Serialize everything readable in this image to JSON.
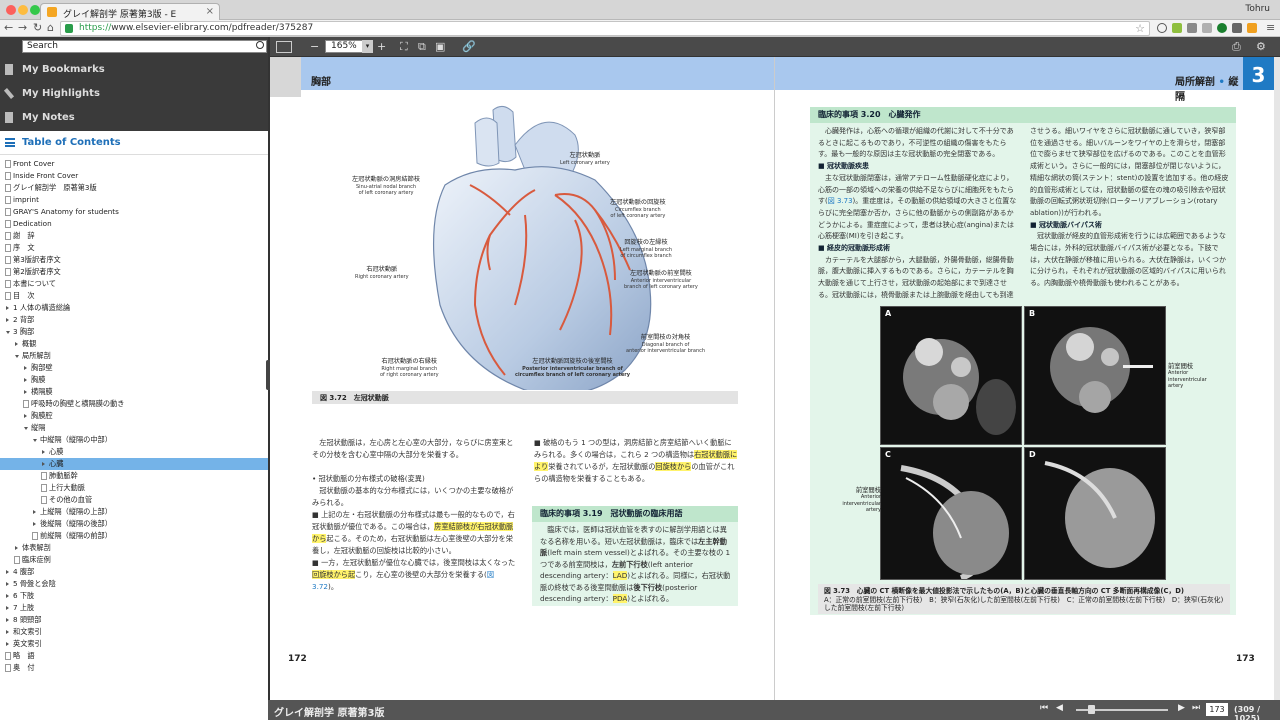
{
  "browser": {
    "tab_title": "グレイ解剖学 原著第3版 - E",
    "url_scheme": "https://",
    "url_rest": "www.elsevier-elibrary.com/pdfreader/375287",
    "user": "Tohru"
  },
  "sidebar": {
    "search_value": "Search",
    "links": [
      "My Bookmarks",
      "My Highlights",
      "My Notes"
    ],
    "toc_title": "Table of Contents",
    "toc": [
      {
        "label": "Front Cover",
        "level": 0,
        "type": "doc"
      },
      {
        "label": "Inside Front Cover",
        "level": 0,
        "type": "doc"
      },
      {
        "label": "グレイ解剖学　原著第3版",
        "level": 0,
        "type": "doc"
      },
      {
        "label": "imprint",
        "level": 0,
        "type": "doc"
      },
      {
        "label": "GRAY'S Anatomy for students",
        "level": 0,
        "type": "doc"
      },
      {
        "label": "Dedication",
        "level": 0,
        "type": "doc"
      },
      {
        "label": "謝　辞",
        "level": 0,
        "type": "doc"
      },
      {
        "label": "序　文",
        "level": 0,
        "type": "doc"
      },
      {
        "label": "第3版訳者序文",
        "level": 0,
        "type": "doc"
      },
      {
        "label": "第2版訳者序文",
        "level": 0,
        "type": "doc"
      },
      {
        "label": "本書について",
        "level": 0,
        "type": "doc"
      },
      {
        "label": "目　次",
        "level": 0,
        "type": "doc"
      },
      {
        "label": "1 人体の構造総論",
        "level": 0,
        "type": "closed"
      },
      {
        "label": "2 背部",
        "level": 0,
        "type": "closed"
      },
      {
        "label": "3 胸部",
        "level": 0,
        "type": "open"
      },
      {
        "label": "概観",
        "level": 1,
        "type": "closed"
      },
      {
        "label": "局所解剖",
        "level": 1,
        "type": "open"
      },
      {
        "label": "胸部壁",
        "level": 2,
        "type": "closed"
      },
      {
        "label": "胸膜",
        "level": 2,
        "type": "closed"
      },
      {
        "label": "横隔膜",
        "level": 2,
        "type": "closed"
      },
      {
        "label": "呼吸時の胸壁と横隔膜の動き",
        "level": 2,
        "type": "doc"
      },
      {
        "label": "胸膜腔",
        "level": 2,
        "type": "closed"
      },
      {
        "label": "縦隔",
        "level": 2,
        "type": "open"
      },
      {
        "label": "中縦隔（縦隔の中部）",
        "level": 3,
        "type": "open"
      },
      {
        "label": "心膜",
        "level": 4,
        "type": "closed"
      },
      {
        "label": "心臓",
        "level": 4,
        "type": "closed",
        "selected": true
      },
      {
        "label": "肺動脈幹",
        "level": 4,
        "type": "doc"
      },
      {
        "label": "上行大動脈",
        "level": 4,
        "type": "doc"
      },
      {
        "label": "その他の血管",
        "level": 4,
        "type": "doc"
      },
      {
        "label": "上縦隔（縦隔の上部）",
        "level": 3,
        "type": "closed"
      },
      {
        "label": "後縦隔（縦隔の後部）",
        "level": 3,
        "type": "closed"
      },
      {
        "label": "前縦隔（縦隔の前部）",
        "level": 3,
        "type": "doc"
      },
      {
        "label": "体表解剖",
        "level": 1,
        "type": "closed"
      },
      {
        "label": "臨床症例",
        "level": 1,
        "type": "doc"
      },
      {
        "label": "4 腹部",
        "level": 0,
        "type": "closed"
      },
      {
        "label": "5 骨盤と会陰",
        "level": 0,
        "type": "closed"
      },
      {
        "label": "6 下肢",
        "level": 0,
        "type": "closed"
      },
      {
        "label": "7 上肢",
        "level": 0,
        "type": "closed"
      },
      {
        "label": "8 頭頸部",
        "level": 0,
        "type": "closed"
      },
      {
        "label": "和文索引",
        "level": 0,
        "type": "closed"
      },
      {
        "label": "英文索引",
        "level": 0,
        "type": "closed"
      },
      {
        "label": "略　語",
        "level": 0,
        "type": "doc"
      },
      {
        "label": "奥　付",
        "level": 0,
        "type": "doc"
      }
    ]
  },
  "toolbar": {
    "zoom": "165%"
  },
  "left_page": {
    "section": "胸部",
    "page_number": "172",
    "figure_caption": "図 3.72　左冠状動脈",
    "labels": {
      "sinu": {
        "jp": "左冠状動脈の洞房結節枝",
        "en": "Sinu-atrial nodal branch\nof left coronary artery"
      },
      "lca": {
        "jp": "左冠状動脈",
        "en": "Left coronary artery"
      },
      "circ": {
        "jp": "左冠状動脈の回旋枝",
        "en": "Circumflex branch\nof left coronary artery"
      },
      "lmb": {
        "jp": "回旋枝の左縁枝",
        "en": "Left marginal branch\nof circumflex branch"
      },
      "rca": {
        "jp": "右冠状動脈",
        "en": "Right coronary artery"
      },
      "aiv": {
        "jp": "左冠状動脈の前室間枝",
        "en": "Anterior interventricular\nbranch of left coronary artery"
      },
      "diag": {
        "jp": "前室間枝の対角枝",
        "en": "Diagonal branch of\nanterior interventricular branch"
      },
      "rmb": {
        "jp": "右冠状動脈の右縁枝",
        "en": "Right marginal branch\nof right coronary artery"
      },
      "piv": {
        "jp": "左冠状動脈回旋枝の後室間枝",
        "en": "Posterior interventricular branch of\ncircumflex branch of left coronary artery"
      }
    },
    "col1_p1": "左冠状動脈は，左心房と左心室の大部分，ならびに房室束とその分枝を含む心室中隔の大部分を栄養する。",
    "col1_bullet_head": "• 冠状動脈の分布様式の破格(変異)",
    "col1_p2": "冠状動脈の基本的な分布様式には，いくつかの主要な破格がみられる。",
    "col1_p3a": "■ 上記の左・右冠状動脈の分布様式は最も一般的なもので，右冠状動脈が優位である。この場合は，",
    "col1_p3_hl": "房室結節枝が右冠状動脈から",
    "col1_p3b": "起こる。そのため，右冠状動脈は左心室後壁の大部分を栄養し，左冠状動脈の回旋枝は比較的小さい。",
    "col1_p4a": "■ 一方，左冠状動脈が優位な心臓では，後室間枝は太くなった",
    "col1_p4_hl": "回旋枝から起",
    "col1_p4b": "こり，左心室の後壁の大部分を栄養する(",
    "col1_p4_ref": "図 3.72",
    "col1_p4c": ")。",
    "col2_p1a": "■ 破格のもう 1 つの型は，洞房結節と房室結節へいく動脈にみられる。多くの場合は，これら 2 つの構造物は",
    "col2_p1_hl": "右冠状動脈により",
    "col2_p1b": "栄養されているが，左冠状動脈の",
    "col2_p1_hl2": "回旋枝から",
    "col2_p1c": "の血管がこれらの構造物を栄養することもある。",
    "box_title": "臨床的事項 3.19　冠状動脈の臨床用語",
    "box_a": "臨床では，医師は冠状血管を表すのに解剖学用語とは異なる名称を用いる。短い左冠状動脈は，臨床では",
    "box_bold1": "左主幹動脈",
    "box_b": "(left main stem vessel)とよばれる。その主要な枝の 1 つである前室間枝は，",
    "box_bold2": "左前下行枝",
    "box_c": "(left anterior descending artery：",
    "box_hl1": "LAD",
    "box_d": ")とよばれる。同様に，右冠状動脈の終枝である後室間動脈は",
    "box_bold3": "後下行枝",
    "box_e": "(posterior descending artery：",
    "box_hl2": "PDA",
    "box_f": ")とよばれる。"
  },
  "right_page": {
    "section_a": "局所解剖",
    "section_sep": "•",
    "section_b": "縦隔",
    "chapter": "3",
    "page_number": "173",
    "box_title": "臨床的事項 3.20　心臓発作",
    "c1_p1": "心臓発作は，心筋への循環が組織の代謝に対して不十分であるときに起こるものであり，不可逆性の組織の傷害をもたらす。最も一般的な原因は主な冠状動脈の完全閉塞である。",
    "c1_h1": "■ 冠状動脈疾患",
    "c1_p2a": "主な冠状動脈閉塞は，通常アテローム性動脈硬化症により，心筋の一部の領域への栄養の供給不足ならびに細胞死をもたらす(",
    "c1_p2_ref": "図 3.73",
    "c1_p2b": ")。重症度は，その動脈の供給領域の大きさと位置ならびに完全閉塞か否か，さらに他の動脈からの側副路があるかどうかによる。重症度によって，患者は狭心症(angina)または心筋梗塞(MI)を引き起こす。",
    "c1_h2": "■ 経皮的冠動脈形成術",
    "c1_p3": "カテーテルを大腿部から，大腿動脈，外腸骨動脈，総腸骨動脈，腹大動脈に挿入するものである。さらに，カテーテルを胸大動脈を通じて上行させ，冠状動脈の起始部にまで到達させる。冠状動脈には，橈骨動脈または上腕動脈を経由しても到達",
    "c2_p1": "させうる。細いワイヤをさらに冠状動脈に通していき，狭窄部位を通過させる。細いバルーンをワイヤの上を滑らせ，閉塞部位で膨らませて狭窄部位を広げるのである。このことを血管形成術という。さらに一般的には，閉塞部位が閉じないように，精細な網状の筒(ステント：stent)の設置を追加する。他の経皮的血管形成術としては，冠状動脈の壁在の塊の吸引除去や冠状動脈の回転式粥状斑切除(ローターリアブレーション(rotary ablation))が行われる。",
    "c2_h1": "■ 冠状動脈バイパス術",
    "c2_p2": "冠状動脈が経皮的血管形成術を行うには広範囲であるような場合には，外科的冠状動脈バイパス術が必要となる。下肢では，大伏在静脈が移植に用いられる。大伏在静脈は，いくつかに分けられ，それぞれが冠状動脈の区域的バイパスに用いられる。内胸動脈や橈骨動脈も使われることがある。",
    "panels": [
      "A",
      "B",
      "C",
      "D"
    ],
    "callout_b": {
      "jp": "前室間枝",
      "en": "Anterior\ninterventricular\nartery"
    },
    "callout_c": {
      "jp": "前室間枝",
      "en": "Anterior\ninterventricular\nartery"
    },
    "fig_caption_title": "図 3.73　心臓の CT 横断像を最大値投影法で示したもの(A，B)と心臓の垂直長軸方向の CT 多断面再構成像(C，D)",
    "fig_caption_body": "A：正常の前室間枝(左前下行枝)　B：狭窄(石灰化)した前室間枝(左前下行枝)　C：正常の前室間枝(左前下行枝)　D：狭窄(石灰化)した前室間枝(左前下行枝)"
  },
  "bottombar": {
    "title": "グレイ解剖学 原著第3版",
    "page_input": "173",
    "page_total": "(309 / 1025)"
  }
}
